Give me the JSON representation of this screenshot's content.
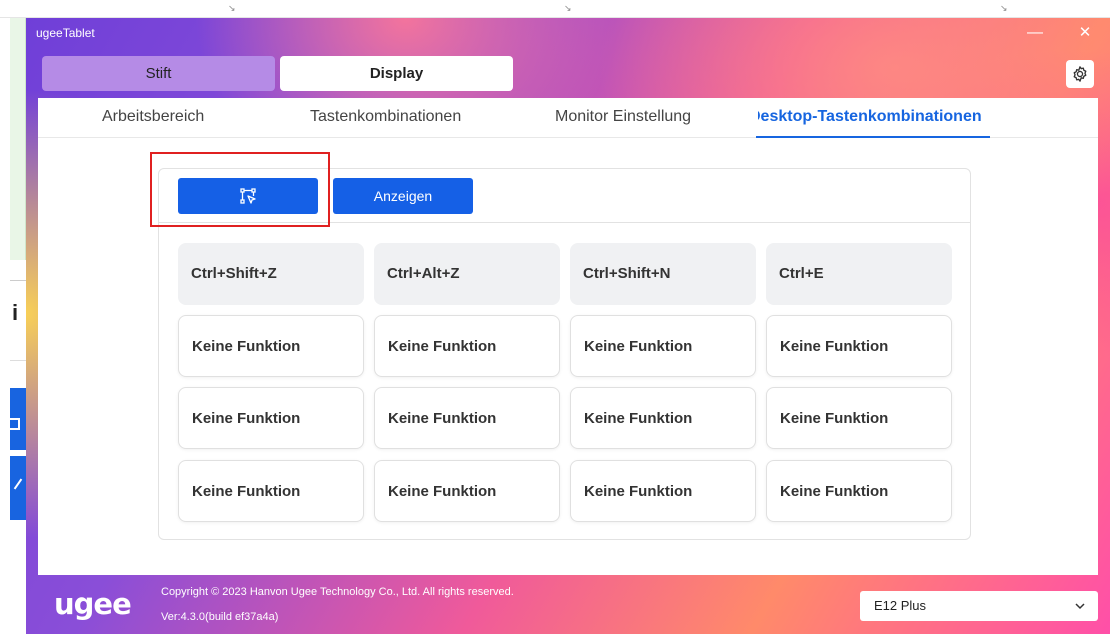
{
  "window": {
    "title": "ugeeTablet",
    "minimize_glyph": "—",
    "close_glyph": "✕"
  },
  "main_tabs": [
    {
      "label": "Stift",
      "active": false
    },
    {
      "label": "Display",
      "active": true
    }
  ],
  "settings": {
    "icon": "gear-icon"
  },
  "sub_tabs": [
    {
      "label": "Arbeitsbereich",
      "active": false
    },
    {
      "label": "Tastenkombinationen",
      "active": false
    },
    {
      "label": "Monitor Einstellung",
      "active": false
    },
    {
      "label": "Desktop-Tastenkombinationen",
      "active": true
    }
  ],
  "toolbar": {
    "edit_icon": "customize-shortcut-icon",
    "show_label": "Anzeigen"
  },
  "shortcuts": [
    [
      "Ctrl+Shift+Z",
      "Ctrl+Alt+Z",
      "Ctrl+Shift+N",
      "Ctrl+E"
    ],
    [
      "Keine Funktion",
      "Keine Funktion",
      "Keine Funktion",
      "Keine Funktion"
    ],
    [
      "Keine Funktion",
      "Keine Funktion",
      "Keine Funktion",
      "Keine Funktion"
    ],
    [
      "Keine Funktion",
      "Keine Funktion",
      "Keine Funktion",
      "Keine Funktion"
    ]
  ],
  "footer": {
    "logo": "ugee",
    "copyright": "Copyright © 2023 Hanvon Ugee Technology Co., Ltd. All rights reserved.",
    "version": "Ver:4.3.0(build ef37a4a)",
    "device": "E12 Plus"
  },
  "background": {
    "left_glyph": "i"
  },
  "colors": {
    "accent": "#1560e6",
    "highlight": "#e02020",
    "stift_tab": "#b58be6"
  }
}
